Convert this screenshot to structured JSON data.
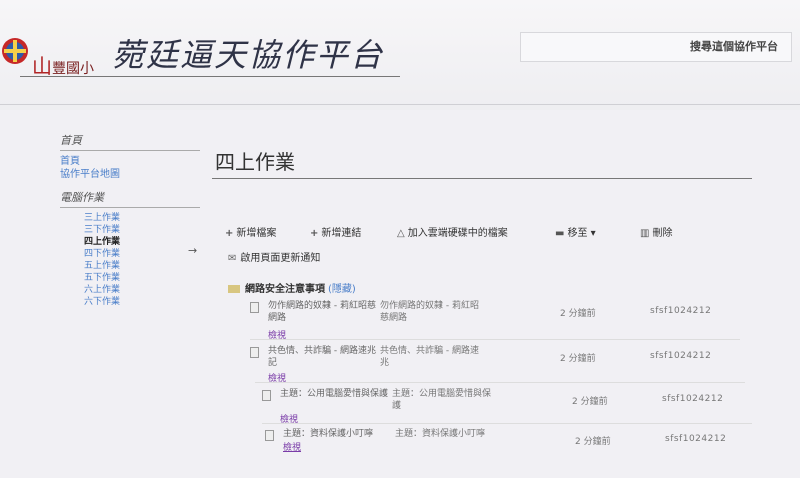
{
  "header": {
    "school_big": "山",
    "school_rest": "豐國小",
    "site_title": "菀廷逼天協作平台",
    "search_label": "搜尋這個協作平台",
    "logo_icon": "school-emblem-icon"
  },
  "sidebar": {
    "home_head": "首頁",
    "home_links": [
      "首頁",
      "協作平台地圖"
    ],
    "work_head": "電腦作業",
    "work_links": [
      "三上作業",
      "三下作業",
      "四上作業",
      "四下作業",
      "五上作業",
      "五下作業",
      "六上作業",
      "六下作業"
    ],
    "current": "四上作業",
    "arrow": "→"
  },
  "main": {
    "page_title": "四上作業",
    "toolbar": {
      "new_file": "新增檔案",
      "new_link": "新增連結",
      "add_drive": "加入雲端硬碟中的檔案",
      "move": "移至",
      "delete": "刪除"
    },
    "notify_label": "啟用頁面更新通知",
    "folder_name": "網路安全注意事項",
    "folder_hide": "(隱藏)",
    "files": [
      {
        "name": "勿作網路的奴隸 - 莉紅昭慈網路",
        "desc": "勿作網路的奴隸 - 莉紅昭慈網路",
        "view": "檢視",
        "time": "2 分鐘前",
        "user": "sfsf1024212"
      },
      {
        "name": "共色情、共詐騙 - 網路速兆記",
        "desc": "共色情、共詐騙 - 網路速兆",
        "view": "檢視",
        "time": "2 分鐘前",
        "user": "sfsf1024212"
      },
      {
        "name": "主題：公用電腦愛惜與保護",
        "desc": "主題：公用電腦愛惜與保護",
        "view": "檢視",
        "time": "2 分鐘前",
        "user": "sfsf1024212"
      },
      {
        "name": "主題：資料保護小叮嚀",
        "desc": "主題：資料保護小叮嚀",
        "view": "檢視",
        "time": "2 分鐘前",
        "user": "sfsf1024212"
      }
    ]
  }
}
